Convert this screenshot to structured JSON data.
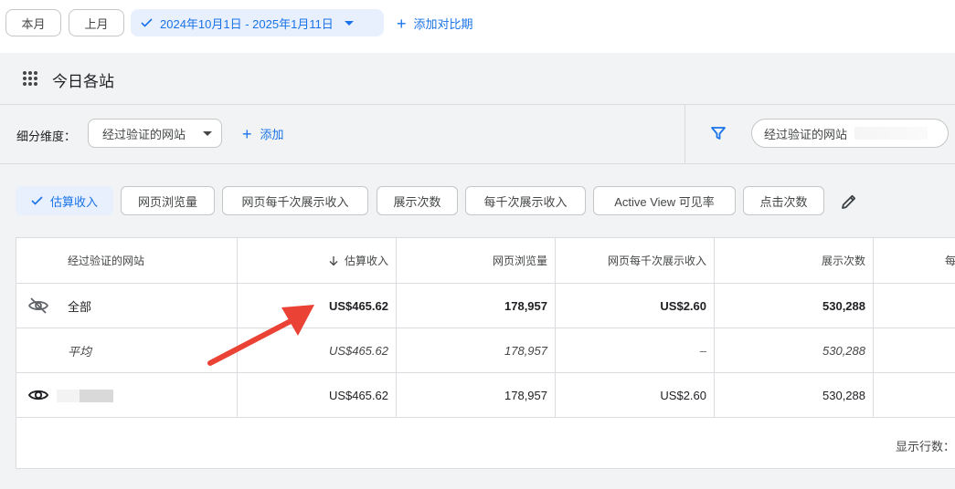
{
  "datebar": {
    "this_month": "本月",
    "last_month": "上月",
    "range": "2024年10月1日 - 2025年1月11日",
    "add_compare": "添加对比期"
  },
  "card": {
    "title": "今日各站",
    "breakdown_label": "细分维度：",
    "breakdown_value": "经过验证的网站",
    "add": "添加",
    "filter_value": "经过验证的网站"
  },
  "metrics": [
    "估算收入",
    "网页浏览量",
    "网页每千次展示收入",
    "展示次数",
    "每千次展示收入",
    "Active View 可见率",
    "点击次数"
  ],
  "table": {
    "headers": [
      "经过验证的网站",
      "估算收入",
      "网页浏览量",
      "网页每千次展示收入",
      "展示次数",
      "每"
    ],
    "rows": [
      [
        "全部",
        "US$465.62",
        "178,957",
        "US$2.60",
        "530,288"
      ],
      [
        "平均",
        "US$465.62",
        "178,957",
        "–",
        "530,288"
      ],
      [
        "",
        "US$465.62",
        "178,957",
        "US$2.60",
        "530,288"
      ]
    ],
    "show_rows": "显示行数："
  },
  "colors": {
    "accent": "#1a73e8",
    "annotation_arrow": "#ea4335"
  }
}
